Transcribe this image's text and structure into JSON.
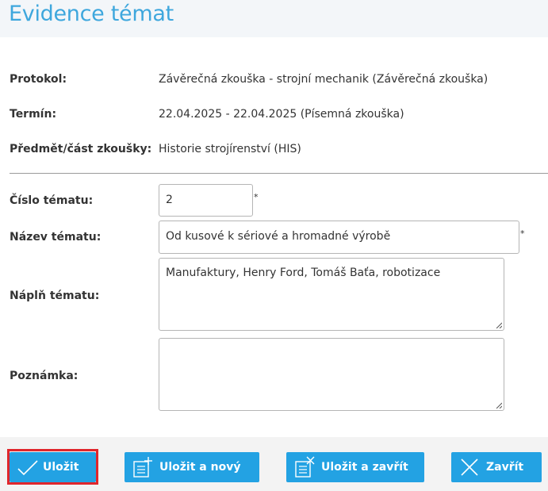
{
  "page": {
    "title": "Evidence témat"
  },
  "info": {
    "protokol": {
      "label": "Protokol:",
      "value": "Závěrečná zkouška - strojní mechanik (Závěrečná zkouška)"
    },
    "termin": {
      "label": "Termín:",
      "value": "22.04.2025 - 22.04.2025 (Písemná zkouška)"
    },
    "predmet": {
      "label": "Předmět/část zkoušky:",
      "value": "Historie strojírenství (HIS)"
    }
  },
  "form": {
    "cislo": {
      "label": "Číslo tématu:",
      "value": "2",
      "required": "*"
    },
    "nazev": {
      "label": "Název tématu:",
      "value": "Od kusové k sériové a hromadné výrobě",
      "required": "*"
    },
    "napln": {
      "label": "Náplň tématu:",
      "value": "Manufaktury, Henry Ford, Tomáš Baťa, robotizace"
    },
    "poznamka": {
      "label": "Poznámka:",
      "value": ""
    }
  },
  "buttons": {
    "save": "Uložit",
    "save_new": "Uložit a nový",
    "save_close": "Uložit a zavřít",
    "close": "Zavřít"
  },
  "colors": {
    "accent": "#23a2e3",
    "title": "#3ea7dd",
    "highlight": "#e0262c"
  }
}
